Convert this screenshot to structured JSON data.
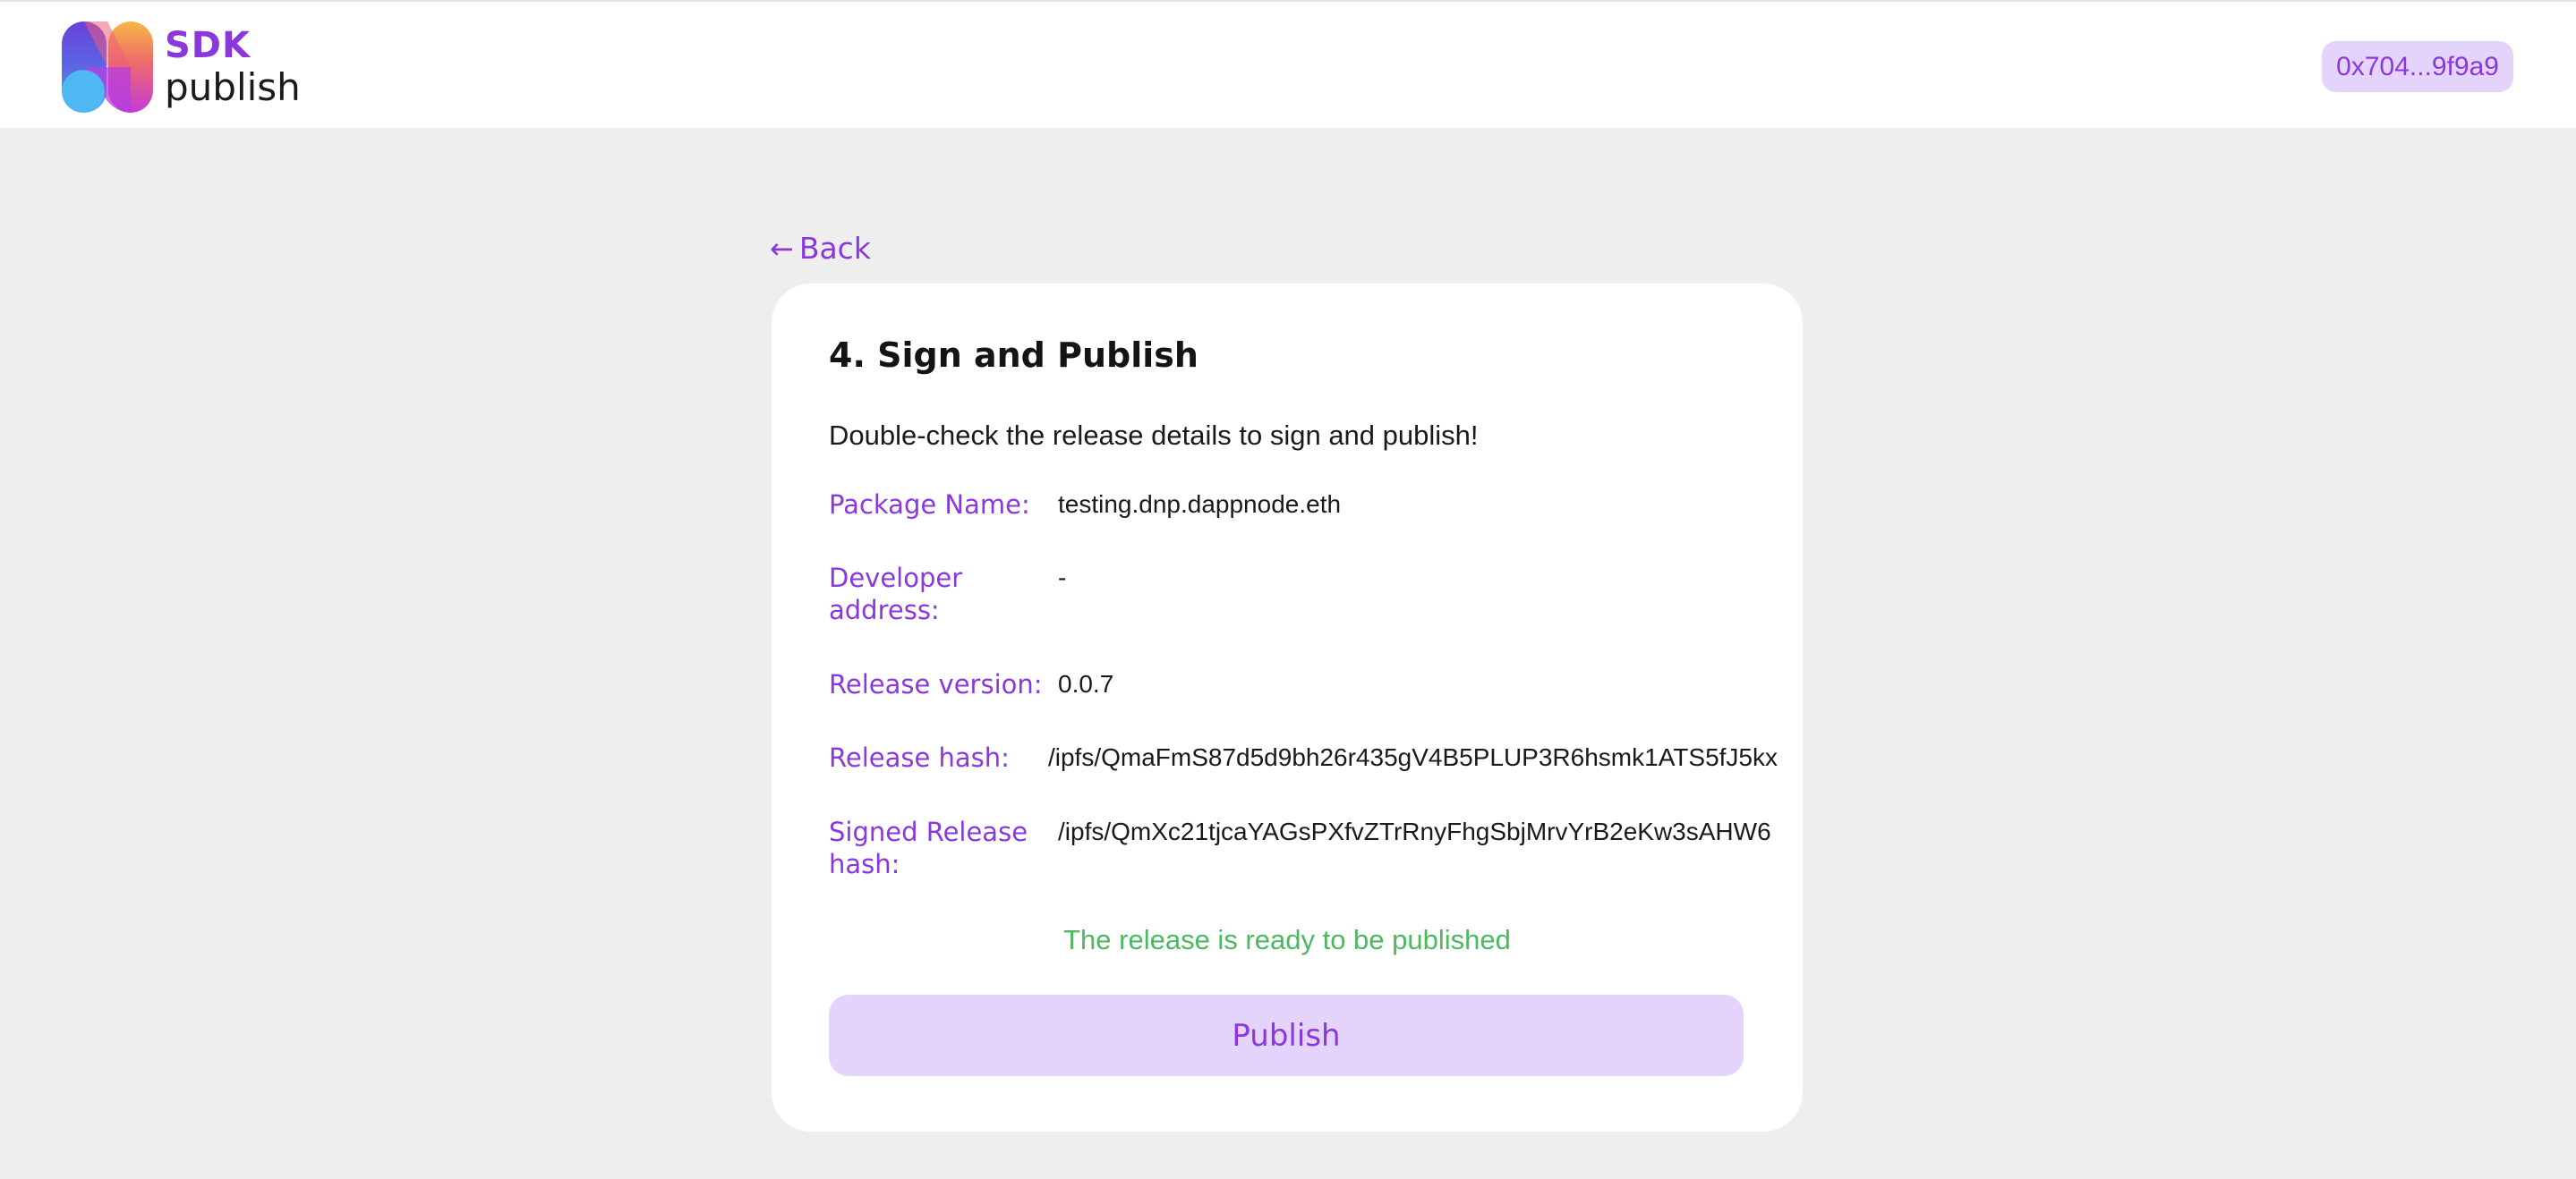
{
  "header": {
    "logo_sdk": "SDK",
    "logo_publish": "publish",
    "account_address": "0x704...9f9a9"
  },
  "nav": {
    "back_label": "Back",
    "back_icon": "arrow-left-icon"
  },
  "card": {
    "title": "4. Sign and Publish",
    "subtitle": "Double-check the release details to sign and publish!",
    "details": [
      {
        "label": "Package Name:",
        "value": "testing.dnp.dappnode.eth"
      },
      {
        "label": "Developer address:",
        "value": "-"
      },
      {
        "label": "Release version:",
        "value": "0.0.7"
      },
      {
        "label": "Release hash:",
        "value": "/ipfs/QmaFmS87d5d9bh26r435gV4B5PLUP3R6hsmk1ATS5fJ5kx"
      },
      {
        "label": "Signed Release hash:",
        "value": "/ipfs/QmXc21tjcaYAGsPXfvZTrRnyFhgSbjMrvYrB2eKw3sAHW6"
      }
    ],
    "status": "The release is ready to be published",
    "publish_label": "Publish"
  },
  "colors": {
    "accent": "#8a38de",
    "accent_light": "#e4d4fb",
    "success": "#4cb961",
    "background": "#eeeeee"
  }
}
